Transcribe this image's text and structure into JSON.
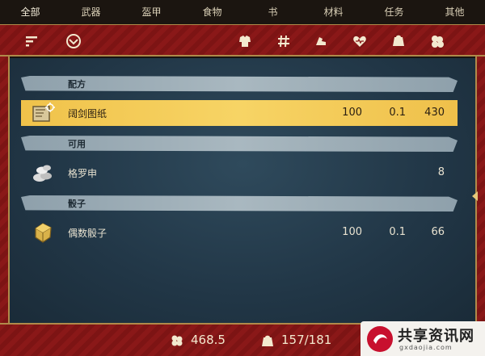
{
  "tabs": [
    {
      "label": "全部",
      "active": true
    },
    {
      "label": "武器"
    },
    {
      "label": "盔甲"
    },
    {
      "label": "食物"
    },
    {
      "label": "书"
    },
    {
      "label": "材料"
    },
    {
      "label": "任务"
    },
    {
      "label": "其他"
    }
  ],
  "toolbar": {
    "icons": [
      "sort-icon",
      "filter-icon",
      "armor-icon",
      "hash-icon",
      "strength-icon",
      "heart-icon",
      "weight-icon",
      "gold-icon"
    ]
  },
  "sections": [
    {
      "label": "配方",
      "items": [
        {
          "name": "阔剑图纸",
          "icon": "blueprint-icon",
          "v1": "100",
          "v2": "0.1",
          "v3": "430",
          "selected": true
        }
      ]
    },
    {
      "label": "可用",
      "items": [
        {
          "name": "格罗申",
          "icon": "coin-pile-icon",
          "v1": "",
          "v2": "",
          "v3": "8"
        }
      ]
    },
    {
      "label": "骰子",
      "items": [
        {
          "name": "偶数骰子",
          "icon": "dice-icon",
          "v1": "100",
          "v2": "0.1",
          "v3": "66"
        }
      ]
    }
  ],
  "status": {
    "money": "468.5",
    "weight": "157/181"
  },
  "watermark": {
    "title": "共享资讯网",
    "sub": "gxdaojia.com"
  },
  "colors": {
    "frame_red": "#8a1818",
    "gold_trim": "#b08a4a",
    "panel_blue": "#213646",
    "selection_yellow": "#f7d465",
    "section_gray": "#a9b8c0"
  }
}
